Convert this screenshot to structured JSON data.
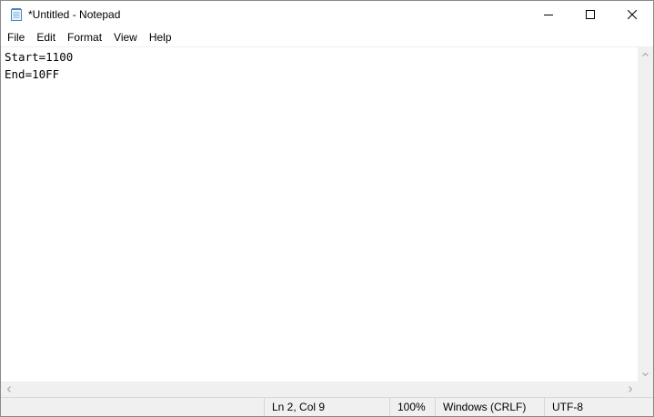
{
  "window": {
    "title": "*Untitled - Notepad",
    "app_icon": "notepad-icon",
    "controls": {
      "minimize_icon": "minimize-icon",
      "maximize_icon": "maximize-icon",
      "close_icon": "close-icon"
    }
  },
  "menu": {
    "items": [
      {
        "label": "File"
      },
      {
        "label": "Edit"
      },
      {
        "label": "Format"
      },
      {
        "label": "View"
      },
      {
        "label": "Help"
      }
    ]
  },
  "editor": {
    "lines": [
      "Start=1100",
      "End=10FF"
    ]
  },
  "statusbar": {
    "position": "Ln 2, Col 9",
    "zoom": "100%",
    "line_ending": "Windows (CRLF)",
    "encoding": "UTF-8"
  },
  "colors": {
    "chrome": "#f0f0f0",
    "background": "#ffffff",
    "border": "#d7d7d7"
  }
}
